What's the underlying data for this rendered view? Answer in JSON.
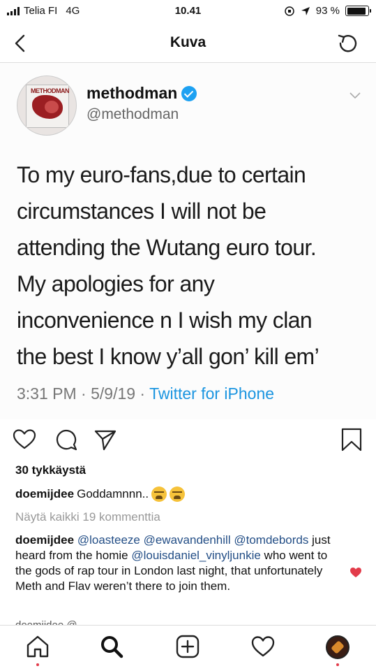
{
  "status_bar": {
    "carrier": "Telia FI",
    "network": "4G",
    "time": "10.41",
    "battery": "93 %",
    "battery_level": 0.93
  },
  "nav": {
    "title": "Kuva"
  },
  "tweet": {
    "display_name": "methodman",
    "handle": "@methodman",
    "avatar_logo": "METHODMAN",
    "lines": [
      "To my euro-fans,due to certain",
      "circumstances I will not be",
      "attending the Wutang euro tour.",
      "My apologies for any",
      "inconvenience n I wish my clan",
      "the best I know y’all gon’ kill em’"
    ],
    "timestamp": "3:31 PM · 5/9/19 · ",
    "source": "Twitter for iPhone"
  },
  "post": {
    "likes": "30 tykkäystä",
    "comments": [
      {
        "user": "doemijdee",
        "text": "Goddamnnn.."
      }
    ],
    "view_all": "Näytä kaikki 19 kommenttia",
    "comment2": {
      "user": "doemijdee",
      "m1": "@loasteeze",
      "m2": "@ewavandenhill",
      "m3": "@tomdebords",
      "t1": " just heard from the homie",
      "m4": "@louisdaniel_vinyljunkie",
      "t2": " who went to the gods of rap tour in London last night, that unfortunately Meth and Flav weren’t there to join them."
    },
    "comment3_partial": "doemijdee @..."
  },
  "colors": {
    "twitter_blue": "#1da1f2",
    "link_blue": "#1b95e0",
    "mention": "#234e86",
    "heart_red": "#e23b4a"
  }
}
